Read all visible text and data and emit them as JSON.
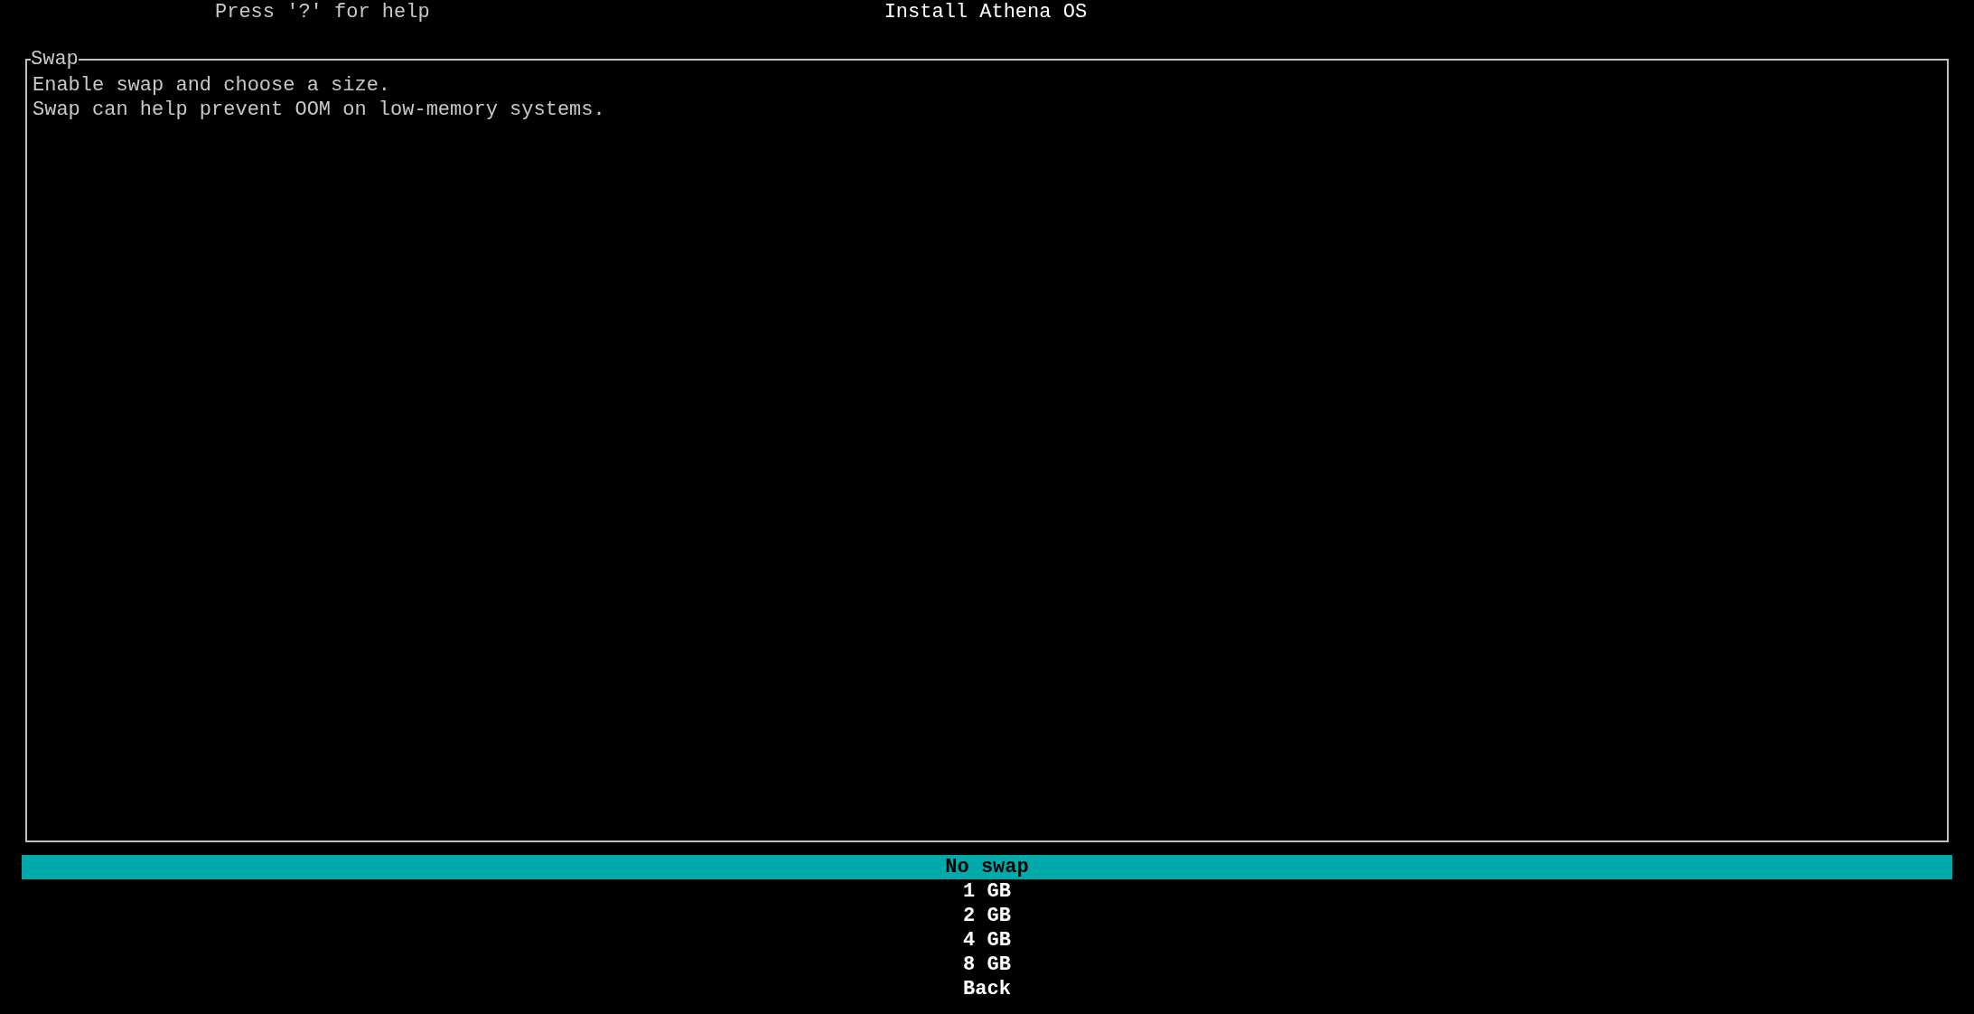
{
  "header": {
    "help_hint": "Press '?' for help",
    "title": "Install Athena OS"
  },
  "panel": {
    "title": "Swap",
    "lines": [
      "Enable swap and choose a size.",
      "Swap can help prevent OOM on low-memory systems."
    ]
  },
  "menu": [
    {
      "label": "No swap",
      "selected": true
    },
    {
      "label": "1 GB",
      "selected": false
    },
    {
      "label": "2 GB",
      "selected": false
    },
    {
      "label": "4 GB",
      "selected": false
    },
    {
      "label": "8 GB",
      "selected": false
    },
    {
      "label": "Back",
      "selected": false
    }
  ]
}
